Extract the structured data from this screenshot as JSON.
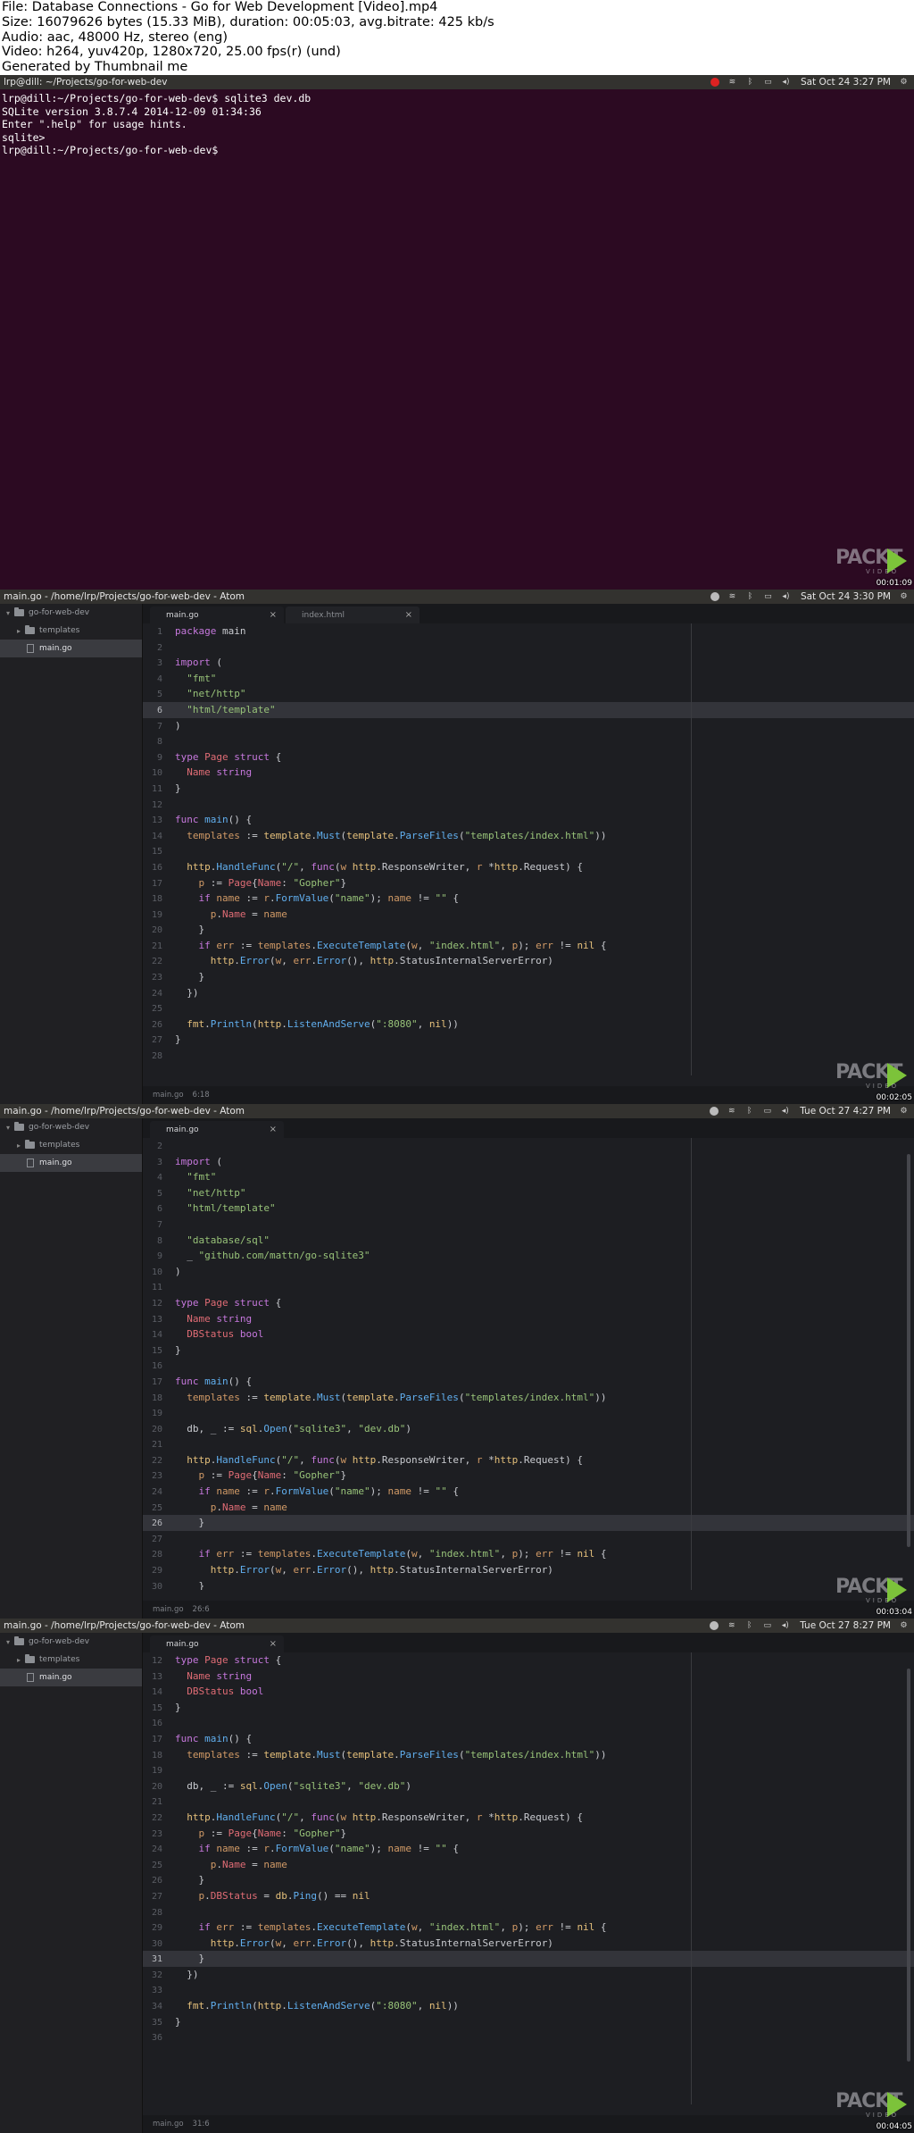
{
  "header": {
    "lines": [
      "File: Database Connections - Go for Web Development [Video].mp4",
      "Size: 16079626 bytes (15.33 MiB), duration: 00:05:03, avg.bitrate: 425 kb/s",
      "Audio: aac, 48000 Hz, stereo (eng)",
      "Video: h264, yuv420p, 1280x720, 25.00 fps(r) (und)",
      "Generated by Thumbnail me"
    ]
  },
  "watermark": {
    "brand": "PACKT",
    "sub": "VIDEO",
    "play_color": "#7cc33a"
  },
  "colors": {
    "terminal_bg": "#2c0a22",
    "editor_bg": "#1d1e22",
    "sidebar_bg": "#202023"
  },
  "frames": [
    {
      "kind": "terminal",
      "window_title": "lrp@dill: ~/Projects/go-for-web-dev",
      "clock": "Sat Oct 24  3:27 PM",
      "timestamp": "00:01:09",
      "lines": [
        "lrp@dill:~/Projects/go-for-web-dev$ sqlite3 dev.db",
        "SQLite version 3.8.7.4 2014-12-09 01:34:36",
        "Enter \".help\" for usage hints.",
        "sqlite>",
        "lrp@dill:~/Projects/go-for-web-dev$"
      ]
    },
    {
      "kind": "atom",
      "window_title": "main.go - /home/lrp/Projects/go-for-web-dev - Atom",
      "clock": "Sat Oct 24  3:30 PM",
      "timestamp": "00:02:05",
      "tree": [
        "go-for-web-dev",
        "templates",
        "main.go"
      ],
      "tabs": [
        "main.go",
        "index.html"
      ],
      "status": [
        "main.go",
        "6:18"
      ],
      "first_line": 1,
      "highlight": 6,
      "code": [
        "package main",
        "",
        "import (",
        "  \"fmt\"",
        "  \"net/http\"",
        "  \"html/template\"",
        ")",
        "",
        "type Page struct {",
        "  Name string",
        "}",
        "",
        "func main() {",
        "  templates := template.Must(template.ParseFiles(\"templates/index.html\"))",
        "",
        "  http.HandleFunc(\"/\", func(w http.ResponseWriter, r *http.Request) {",
        "    p := Page{Name: \"Gopher\"}",
        "    if name := r.FormValue(\"name\"); name != \"\" {",
        "      p.Name = name",
        "    }",
        "    if err := templates.ExecuteTemplate(w, \"index.html\", p); err != nil {",
        "      http.Error(w, err.Error(), http.StatusInternalServerError)",
        "    }",
        "  })",
        "",
        "  fmt.Println(http.ListenAndServe(\":8080\", nil))",
        "}",
        ""
      ]
    },
    {
      "kind": "atom",
      "window_title": "main.go - /home/lrp/Projects/go-for-web-dev - Atom",
      "clock": "Tue Oct 27  4:27 PM",
      "timestamp": "00:03:04",
      "tree": [
        "go-for-web-dev",
        "templates",
        "main.go"
      ],
      "tabs": [
        "main.go"
      ],
      "status": [
        "main.go",
        "26:6"
      ],
      "first_line": 2,
      "highlight": 26,
      "code": [
        "",
        "import (",
        "  \"fmt\"",
        "  \"net/http\"",
        "  \"html/template\"",
        "",
        "  \"database/sql\"",
        "  _ \"github.com/mattn/go-sqlite3\"",
        ")",
        "",
        "type Page struct {",
        "  Name string",
        "  DBStatus bool",
        "}",
        "",
        "func main() {",
        "  templates := template.Must(template.ParseFiles(\"templates/index.html\"))",
        "",
        "  db, _ := sql.Open(\"sqlite3\", \"dev.db\")",
        "",
        "  http.HandleFunc(\"/\", func(w http.ResponseWriter, r *http.Request) {",
        "    p := Page{Name: \"Gopher\"}",
        "    if name := r.FormValue(\"name\"); name != \"\" {",
        "      p.Name = name",
        "    }",
        "",
        "    if err := templates.ExecuteTemplate(w, \"index.html\", p); err != nil {",
        "      http.Error(w, err.Error(), http.StatusInternalServerError)",
        "    }"
      ]
    },
    {
      "kind": "atom",
      "window_title": "main.go - /home/lrp/Projects/go-for-web-dev - Atom",
      "clock": "Tue Oct 27  8:27 PM",
      "timestamp": "00:04:05",
      "tree": [
        "go-for-web-dev",
        "templates",
        "main.go"
      ],
      "tabs": [
        "main.go"
      ],
      "status": [
        "main.go",
        "31:6"
      ],
      "first_line": 12,
      "highlight": 31,
      "code": [
        "type Page struct {",
        "  Name string",
        "  DBStatus bool",
        "}",
        "",
        "func main() {",
        "  templates := template.Must(template.ParseFiles(\"templates/index.html\"))",
        "",
        "  db, _ := sql.Open(\"sqlite3\", \"dev.db\")",
        "",
        "  http.HandleFunc(\"/\", func(w http.ResponseWriter, r *http.Request) {",
        "    p := Page{Name: \"Gopher\"}",
        "    if name := r.FormValue(\"name\"); name != \"\" {",
        "      p.Name = name",
        "    }",
        "    p.DBStatus = db.Ping() == nil",
        "",
        "    if err := templates.ExecuteTemplate(w, \"index.html\", p); err != nil {",
        "      http.Error(w, err.Error(), http.StatusInternalServerError)",
        "    }",
        "  })",
        "",
        "  fmt.Println(http.ListenAndServe(\":8080\", nil))",
        "}",
        ""
      ]
    }
  ]
}
